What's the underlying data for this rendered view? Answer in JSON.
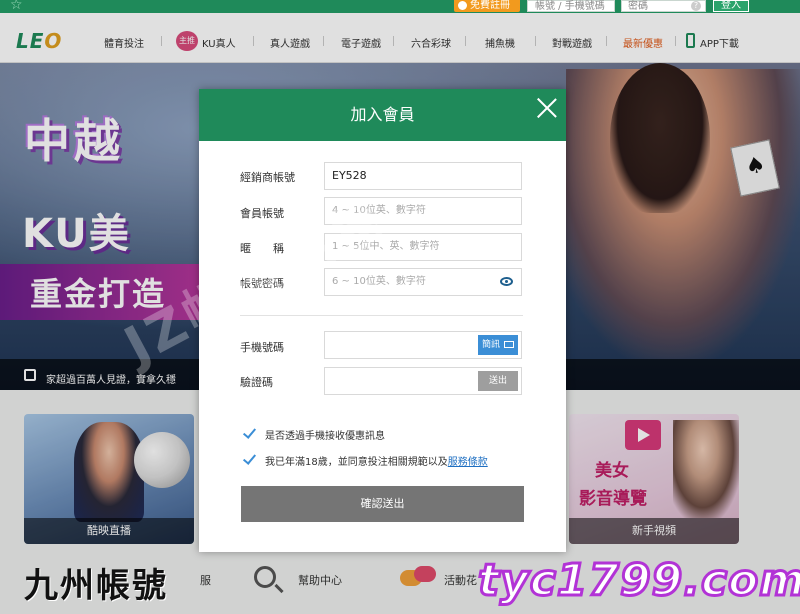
{
  "topbar": {
    "register_label": "免費註冊",
    "account_placeholder": "帳號 / 手機號碼",
    "password_placeholder": "密碼",
    "help_glyph": "?",
    "login_label": "登入"
  },
  "nav": {
    "logo_a": "LE",
    "logo_b": "O",
    "ku_badge": "主推",
    "items": [
      "體育投注",
      "KU真人",
      "真人遊戲",
      "電子遊戲",
      "六合彩球",
      "捕魚機",
      "對戰遊戲",
      "最新優惠",
      "APP下載"
    ]
  },
  "banner": {
    "headline1": "中越",
    "headline2": "KU美",
    "headline3": "重金打造",
    "ticker": "家超過百萬人見證，實拿久穩"
  },
  "cards": {
    "live_caption": "酷映直播",
    "video_title1": "美女",
    "video_title2": "影音導覽",
    "video_caption": "新手視頻"
  },
  "bottom_links": {
    "service": "服",
    "help": "幫助中心",
    "events": "活動花"
  },
  "modal": {
    "title": "加入會員",
    "fields": {
      "agent_label": "經銷商帳號",
      "agent_value": "EY528",
      "account_label": "會員帳號",
      "account_placeholder": "4 ~ 10位英、數字符",
      "nickname_label": "暱　　稱",
      "nickname_placeholder": "1 ~ 5位中、英、數字符",
      "password_label": "帳號密碼",
      "password_placeholder": "6 ~ 10位英、數字符",
      "phone_label": "手機號碼",
      "sms_button": "簡訊",
      "code_label": "驗證碼",
      "send_button": "送出"
    },
    "checks": {
      "sms_optin": "是否透過手機接收優惠訊息",
      "age_prefix": "我已年滿18歲，並同意投注相關規範以及",
      "terms_link": "服務條款"
    },
    "submit_label": "確認送出"
  },
  "watermarks": {
    "left": "九州帳號",
    "right": "tyc1799.com",
    "center": "JZ帳號出售"
  },
  "colors": {
    "brand_green": "#1f8a5a",
    "accent_orange": "#f29a1e",
    "sms_blue": "#3b8ed6",
    "submit_gray": "#757575"
  }
}
